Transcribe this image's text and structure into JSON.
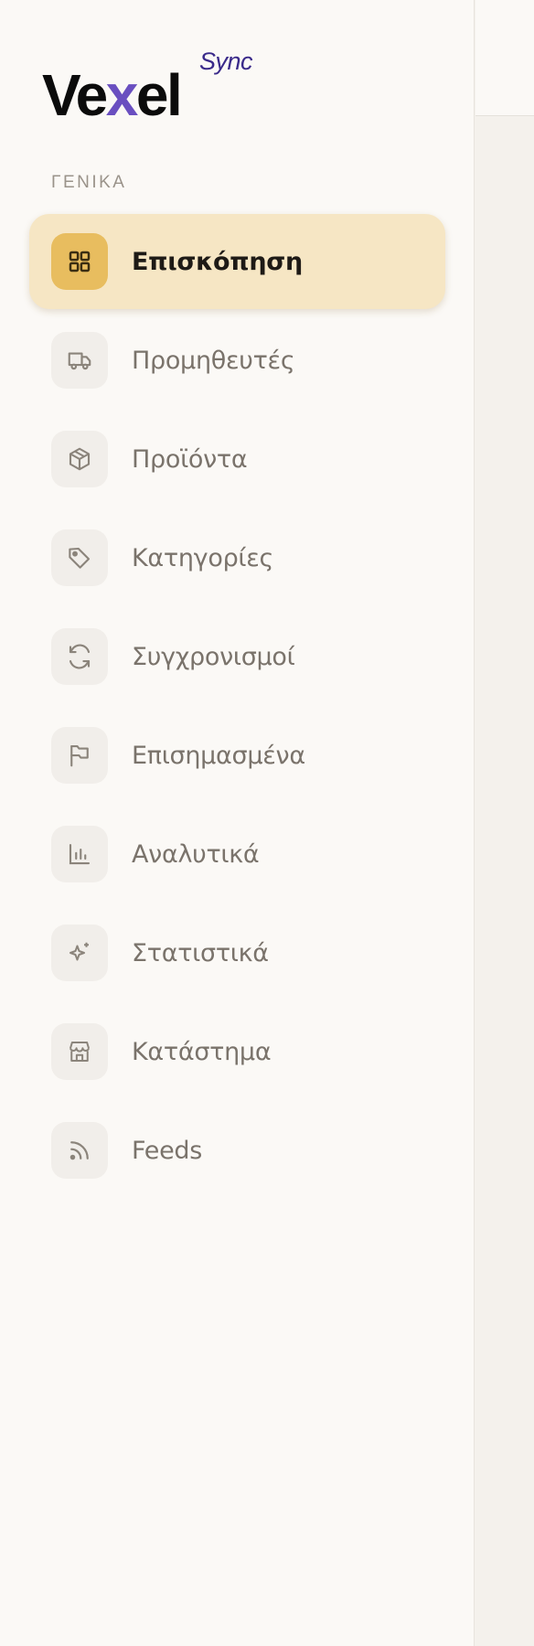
{
  "logo": {
    "brand_pre": "Ve",
    "brand_x": "x",
    "brand_post": "el",
    "brand_sub": "Sync"
  },
  "sidebar": {
    "section_label": "ΓΕΝΙΚΑ",
    "items": [
      {
        "label": "Επισκόπηση",
        "icon": "grid-icon",
        "active": true
      },
      {
        "label": "Προμηθευτές",
        "icon": "truck-icon"
      },
      {
        "label": "Προϊόντα",
        "icon": "box-icon"
      },
      {
        "label": "Κατηγορίες",
        "icon": "tag-icon"
      },
      {
        "label": "Συγχρονισμοί",
        "icon": "refresh-icon"
      },
      {
        "label": "Επισημασμένα",
        "icon": "flag-icon"
      },
      {
        "label": "Αναλυτικά",
        "icon": "bar-chart-icon"
      },
      {
        "label": "Στατιστικά",
        "icon": "sparkles-icon"
      },
      {
        "label": "Κατάστημα",
        "icon": "store-icon"
      },
      {
        "label": "Feeds",
        "icon": "rss-icon"
      }
    ]
  },
  "colors": {
    "active_bg": "#f6e6c4",
    "active_icon_bg": "#e8bd5f",
    "brand_accent": "#6a4fc0",
    "sync_color": "#3a2a8a"
  }
}
